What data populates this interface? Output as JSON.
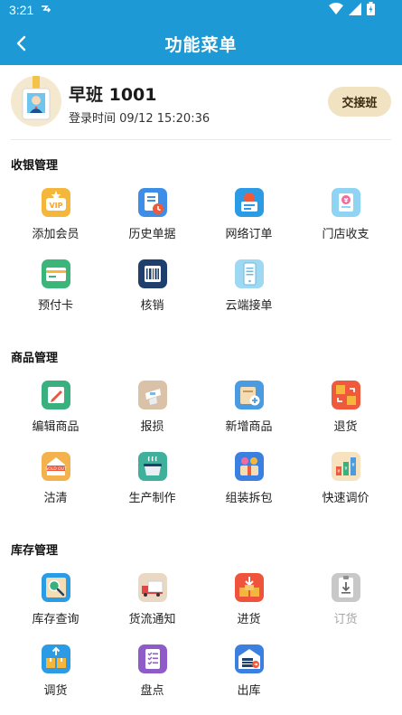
{
  "status_bar": {
    "time": "3:21"
  },
  "header": {
    "title": "功能菜单"
  },
  "user": {
    "name": "早班 1001",
    "login_time": "登录时间 09/12 15:20:36",
    "handover_label": "交接班"
  },
  "sections": [
    {
      "title": "收银管理",
      "items": [
        {
          "label": "添加会员",
          "icon": "vip-card-icon",
          "color": "#f4b73b"
        },
        {
          "label": "历史单据",
          "icon": "history-receipt-icon",
          "color": "#3d8ee8"
        },
        {
          "label": "网络订单",
          "icon": "online-order-icon",
          "color": "#2b9be6"
        },
        {
          "label": "门店收支",
          "icon": "store-cash-icon",
          "color": "#8fd5f3"
        },
        {
          "label": "预付卡",
          "icon": "prepaid-card-icon",
          "color": "#3cb57a"
        },
        {
          "label": "核销",
          "icon": "barcode-verify-icon",
          "color": "#1f3f6d"
        },
        {
          "label": "云端接单",
          "icon": "cloud-order-phone-icon",
          "color": "#9fd8f2"
        }
      ]
    },
    {
      "title": "商品管理",
      "items": [
        {
          "label": "编辑商品",
          "icon": "edit-product-icon",
          "color": "#3bb07f"
        },
        {
          "label": "报损",
          "icon": "damage-report-icon",
          "color": "#d9c2a8"
        },
        {
          "label": "新增商品",
          "icon": "new-product-icon",
          "color": "#4a9be0"
        },
        {
          "label": "退货",
          "icon": "return-goods-icon",
          "color": "#f05a3c"
        },
        {
          "label": "沽清",
          "icon": "sold-out-icon",
          "color": "#f3b24e"
        },
        {
          "label": "生产制作",
          "icon": "production-pot-icon",
          "color": "#3fb09c"
        },
        {
          "label": "组装拆包",
          "icon": "assemble-package-icon",
          "color": "#3b80e0"
        },
        {
          "label": "快速调价",
          "icon": "quick-price-icon",
          "color": "#f6e2bf"
        }
      ]
    },
    {
      "title": "库存管理",
      "items": [
        {
          "label": "库存查询",
          "icon": "inventory-search-icon",
          "color": "#2b9be6"
        },
        {
          "label": "货流通知",
          "icon": "logistics-truck-icon",
          "color": "#e9d9c4"
        },
        {
          "label": "进货",
          "icon": "purchase-in-icon",
          "color": "#f0533b"
        },
        {
          "label": "订货",
          "icon": "order-goods-icon",
          "color": "#c8c8c8",
          "disabled": true
        },
        {
          "label": "调货",
          "icon": "transfer-goods-icon",
          "color": "#2b9be6"
        },
        {
          "label": "盘点",
          "icon": "stocktake-checklist-icon",
          "color": "#8e5bc9"
        },
        {
          "label": "出库",
          "icon": "warehouse-out-icon",
          "color": "#3b80e0"
        }
      ]
    }
  ]
}
